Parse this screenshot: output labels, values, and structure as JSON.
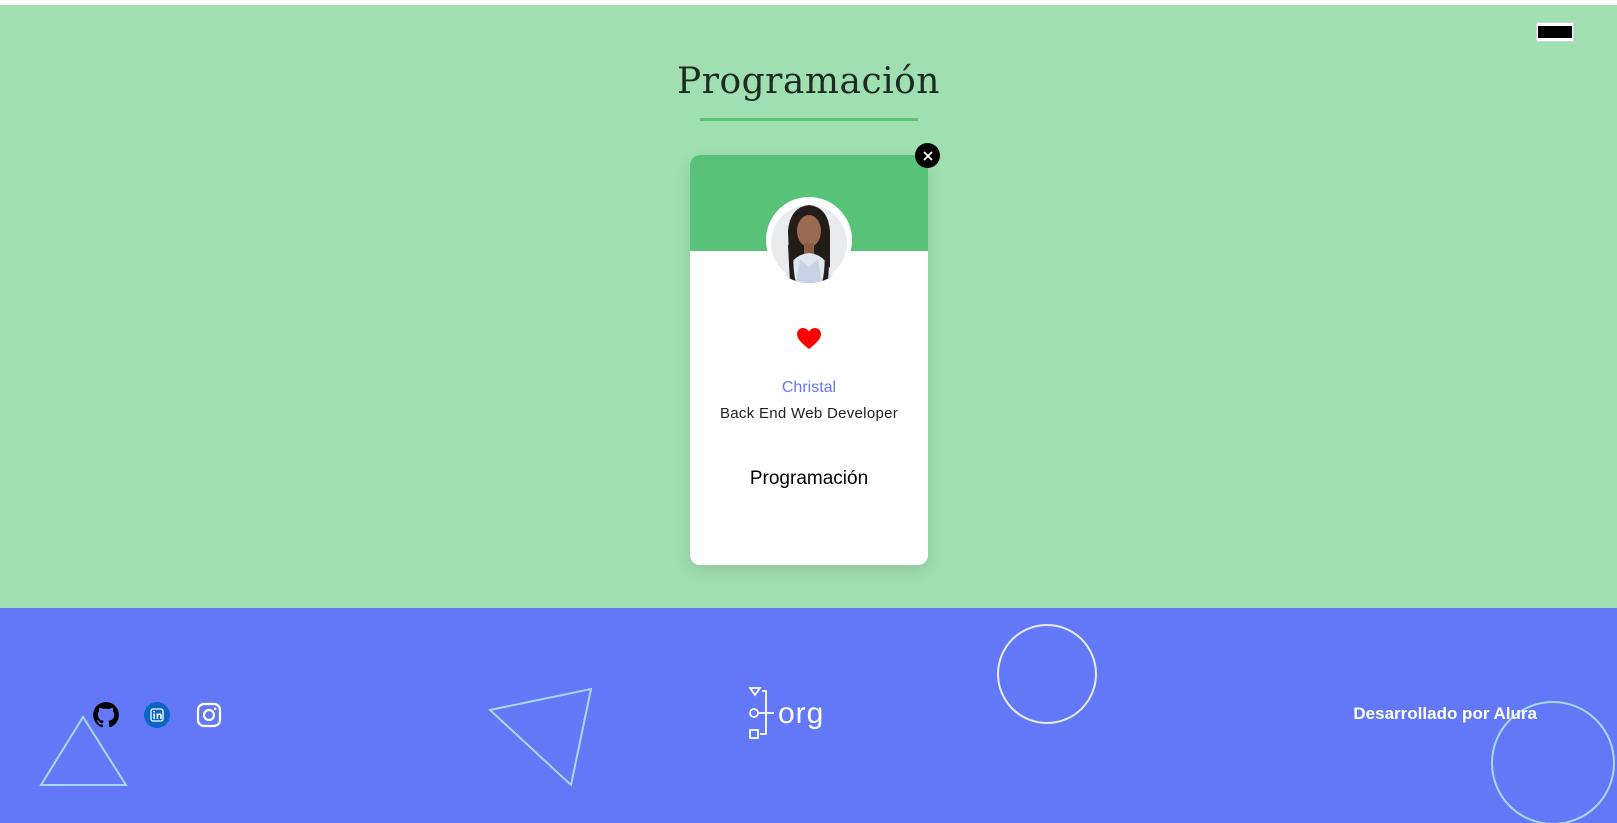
{
  "section": {
    "title": "Programación",
    "accent_color": "#57C278",
    "background_color": "#9FDFB1"
  },
  "top_right_button": {
    "icon": "toggle-form-icon"
  },
  "card": {
    "name": "Christal",
    "role": "Back End Web Developer",
    "team": "Programación",
    "favorite": true,
    "favorite_color": "#FF0000",
    "delete_icon": "close-icon",
    "avatar_icon": "profile-photo"
  },
  "footer": {
    "background_color": "#6278F7",
    "social": [
      {
        "name": "github",
        "icon": "github-icon"
      },
      {
        "name": "linkedin",
        "icon": "linkedin-icon"
      },
      {
        "name": "instagram",
        "icon": "instagram-icon"
      }
    ],
    "logo_text": "org",
    "credit": "Desarrollado por Alura"
  }
}
